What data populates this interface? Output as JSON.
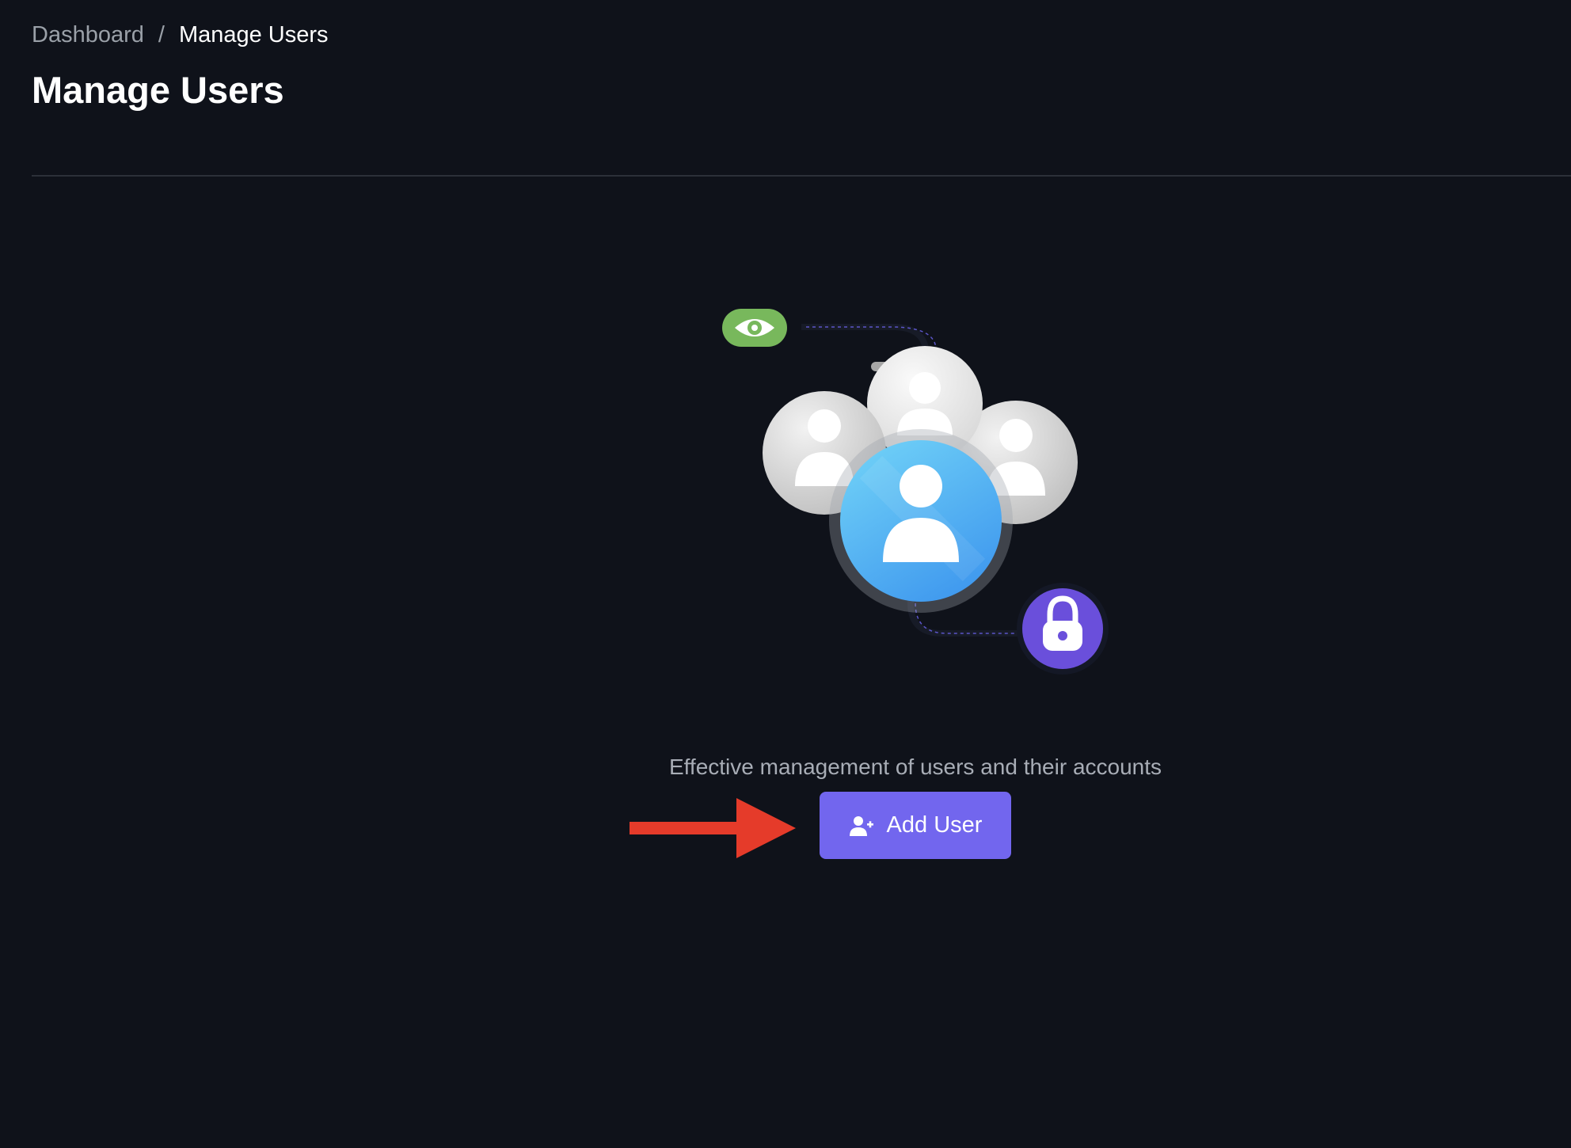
{
  "breadcrumb": {
    "items": [
      {
        "label": "Dashboard"
      },
      {
        "label": "Manage Users"
      }
    ],
    "separator": "/"
  },
  "header": {
    "title": "Manage Users"
  },
  "empty_state": {
    "description": "Effective management of users and their accounts",
    "add_button_label": "Add User",
    "add_button_icon": "user-plus-icon",
    "illustration_icons": [
      "eye-icon",
      "user-avatar-icon",
      "lock-icon"
    ]
  },
  "colors": {
    "background": "#0f121a",
    "accent": "#7266ee",
    "annotation_arrow": "#e53b2a",
    "eye_badge": "#78b85c",
    "lock_badge": "#6a4fdb",
    "primary_avatar": "#4da6f5"
  }
}
